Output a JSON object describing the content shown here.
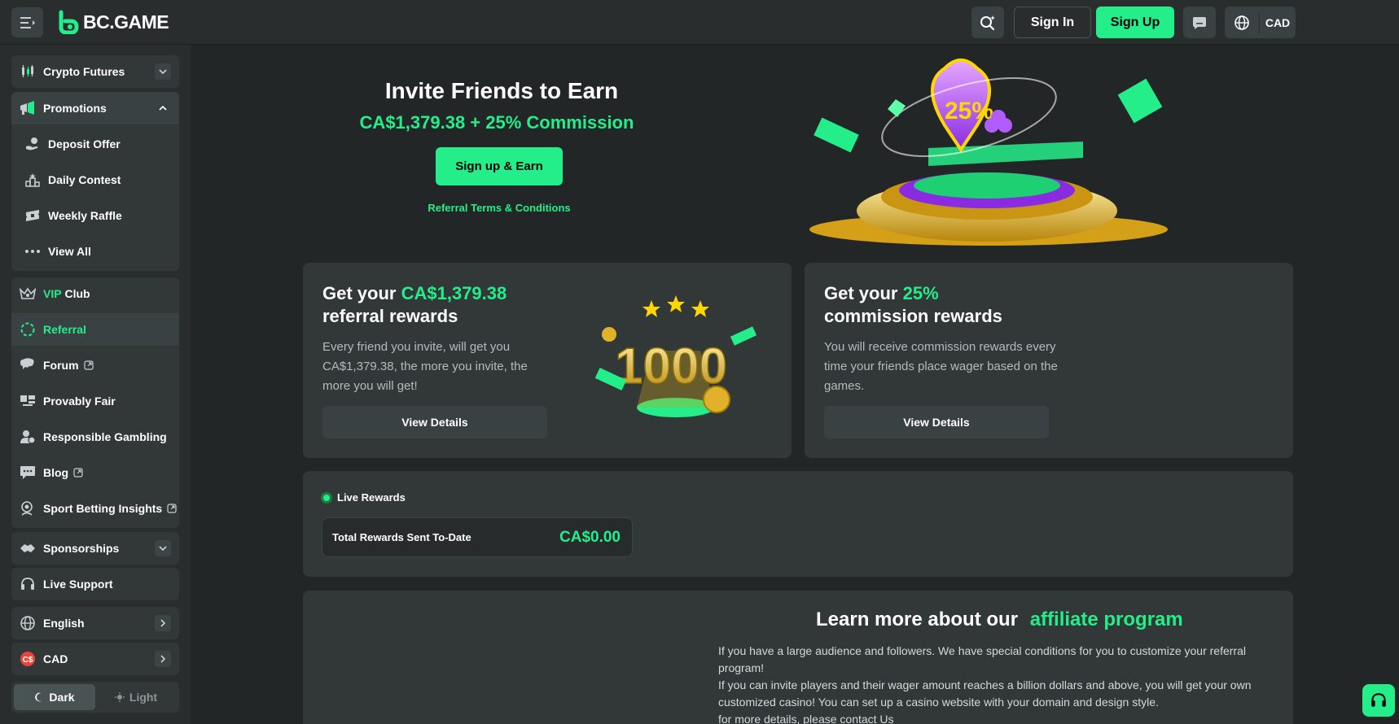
{
  "brand": {
    "logo_text": "BC.GAME",
    "accent": "#24ee89"
  },
  "header": {
    "signin_label": "Sign In",
    "signup_label": "Sign Up",
    "currency_label": "CAD"
  },
  "sidebar": {
    "crypto_futures": "Crypto Futures",
    "promotions": "Promotions",
    "promo_items": [
      "Deposit Offer",
      "Daily Contest",
      "Weekly Raffle",
      "View All"
    ],
    "vip_prefix": "VIP",
    "vip_suffix": "Club",
    "referral": "Referral",
    "forum": "Forum",
    "provably_fair": "Provably Fair",
    "responsible_gambling": "Responsible Gambling",
    "blog": "Blog",
    "sport_insights": "Sport Betting Insights",
    "sponsorships": "Sponsorships",
    "live_support": "Live Support",
    "language": "English",
    "currency": "CAD",
    "theme_dark": "Dark",
    "theme_light": "Light"
  },
  "hero": {
    "title": "Invite Friends to Earn",
    "amount_line": "CA$1,379.38 + 25% Commission",
    "cta": "Sign up & Earn",
    "terms": "Referral Terms & Conditions",
    "badge_text": "25%"
  },
  "referral_card": {
    "title_prefix": "Get your",
    "title_highlight": "CA$1,379.38",
    "title_line2": "referral rewards",
    "description": "Every friend you invite, will get you CA$1,379.38, the more you invite, the more you will get!",
    "button": "View Details",
    "graphic_number": "1000"
  },
  "commission_card": {
    "title_prefix": "Get your",
    "title_highlight": "25%",
    "title_line2": "commission rewards",
    "description": "You will receive commission rewards every time your friends place wager based on the games.",
    "button": "View Details"
  },
  "live_rewards": {
    "label": "Live Rewards",
    "total_label": "Total Rewards Sent To-Date",
    "total_value": "CA$0.00"
  },
  "affiliate": {
    "title": "Learn more about our",
    "title_highlight": "affiliate program",
    "para1": "If you have a large audience and followers. We have special conditions for you to customize your referral program!",
    "para2": "If you can invite players and their wager amount reaches a billion dollars and above, you will get your own customized casino! You can set up a casino website with your domain and design style.",
    "para3": "for more details, please contact Us"
  }
}
